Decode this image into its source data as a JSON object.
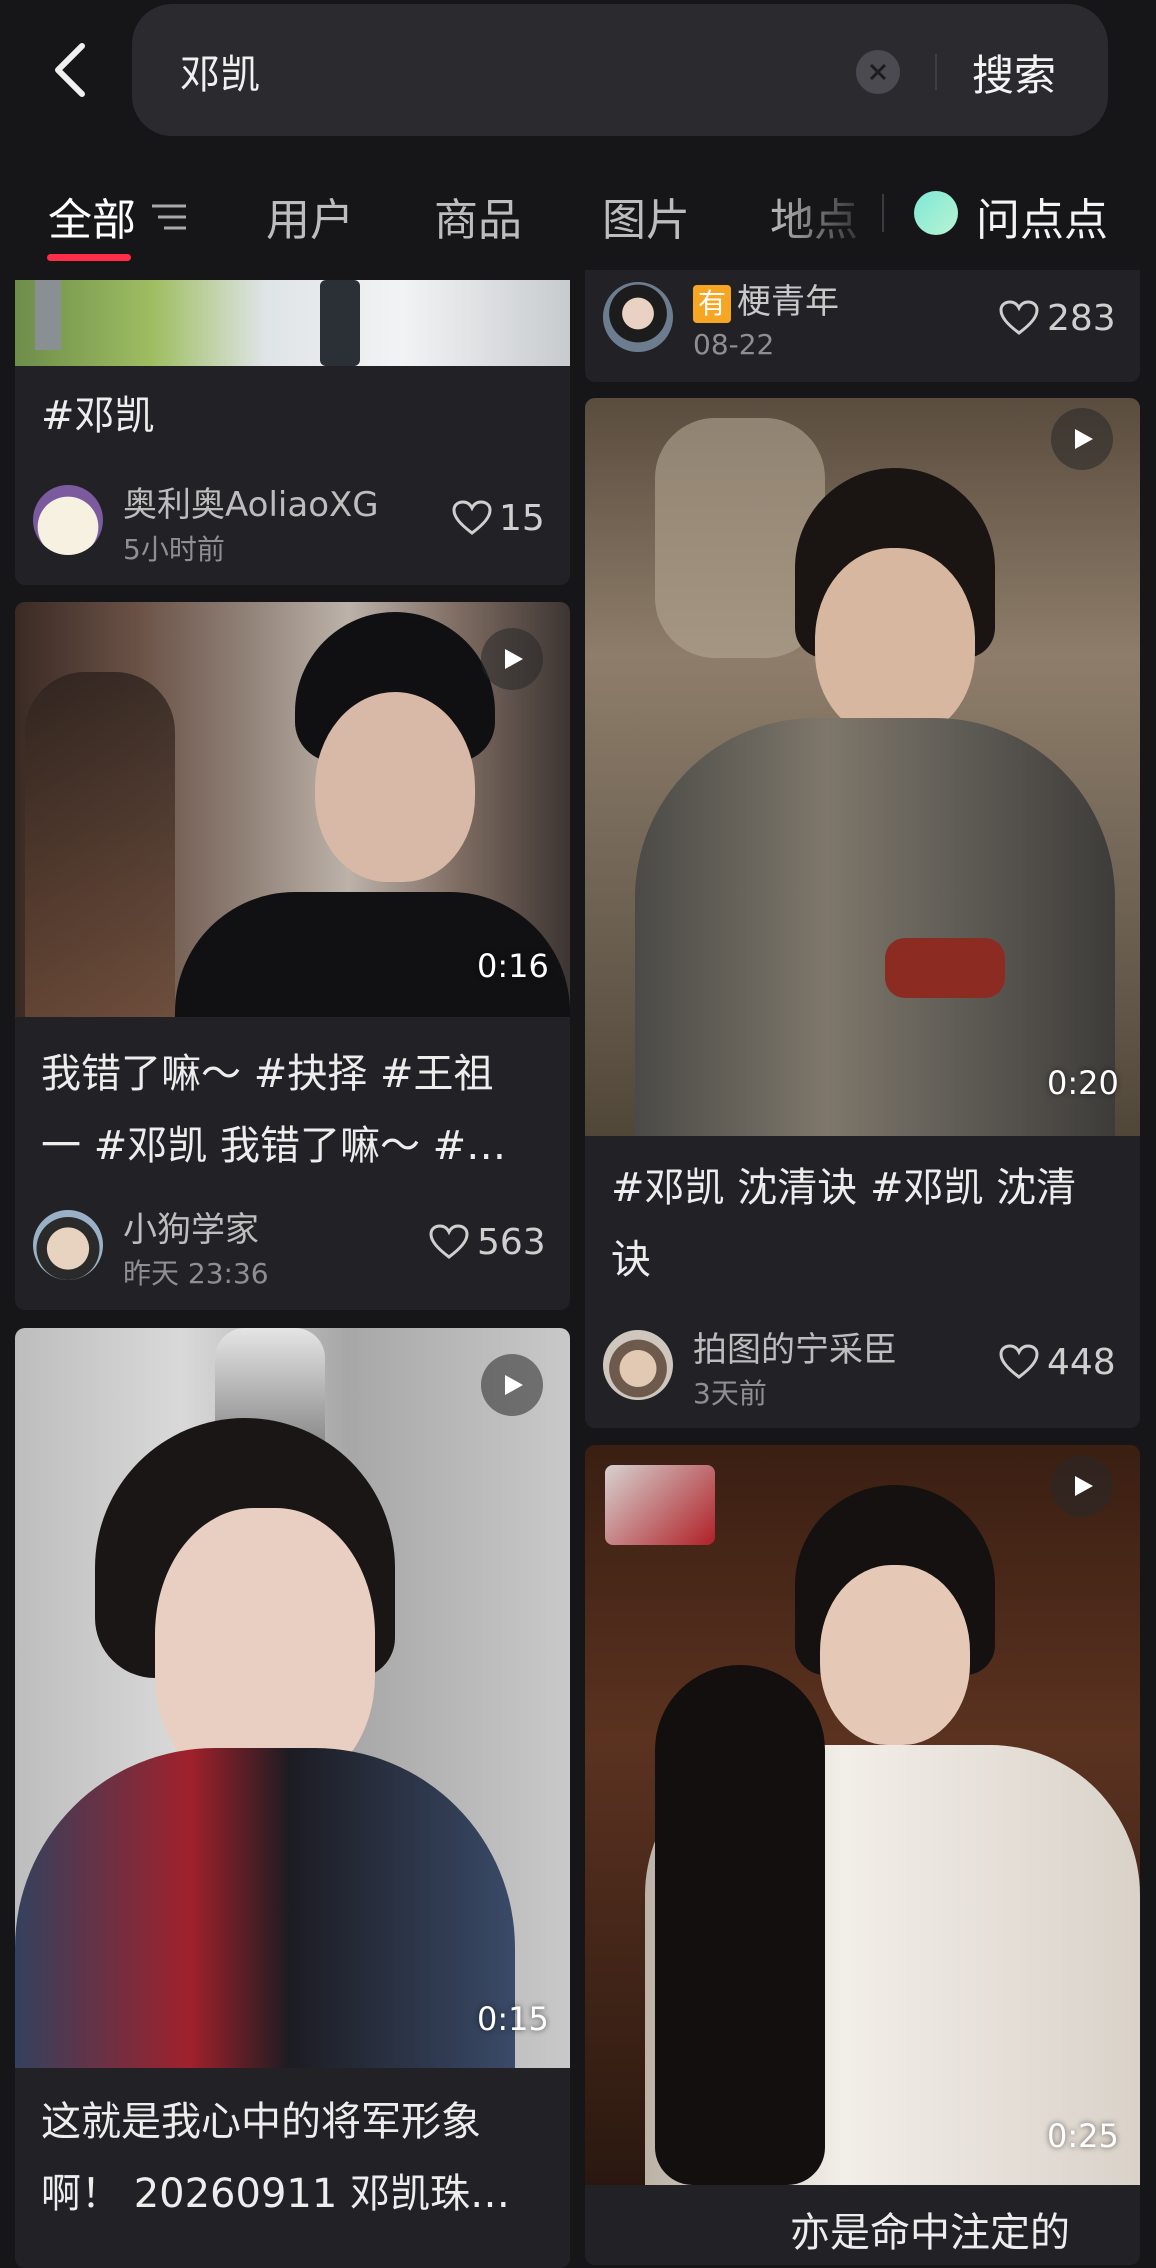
{
  "search": {
    "query": "邓凯",
    "button": "搜索"
  },
  "tabs": [
    {
      "label": "全部"
    },
    {
      "label": "用户"
    },
    {
      "label": "商品"
    },
    {
      "label": "图片"
    },
    {
      "label": "地点"
    },
    {
      "label": "问点点"
    }
  ],
  "icons": {
    "back": "chevron-left-icon",
    "clear": "close-circle-icon",
    "filter": "filter-icon",
    "play": "play-icon",
    "like": "heart-icon"
  },
  "colors": {
    "accent": "#ff2d4a",
    "background": "#161619",
    "card": "#222226"
  },
  "cards": {
    "c1": {
      "title": "#邓凯",
      "author": "奥利奥AoliaoXG",
      "time": "5小时前",
      "likes": "15"
    },
    "c2": {
      "title_line1": "我错了嘛～ #抉择 #王祖",
      "title_line2": "一 #邓凯 我错了嘛～ #…",
      "author": "小狗学家",
      "time": "昨天 23:36",
      "likes": "563",
      "duration": "0:16"
    },
    "c3": {
      "title_line1": "这就是我心中的将军形象",
      "title_line2": "啊！ 20260911 邓凯珠…",
      "duration": "0:15"
    },
    "c4": {
      "badge": "有",
      "author": "梗青年",
      "time": "08-22",
      "likes": "283"
    },
    "c5": {
      "title_line1": "#邓凯 沈清诀 #邓凯 沈清",
      "title_line2": "诀",
      "author": "拍图的宁采臣",
      "time": "3天前",
      "likes": "448",
      "duration": "0:20"
    },
    "c6": {
      "title_partial": "亦是命中注定的",
      "duration": "0:25"
    }
  }
}
